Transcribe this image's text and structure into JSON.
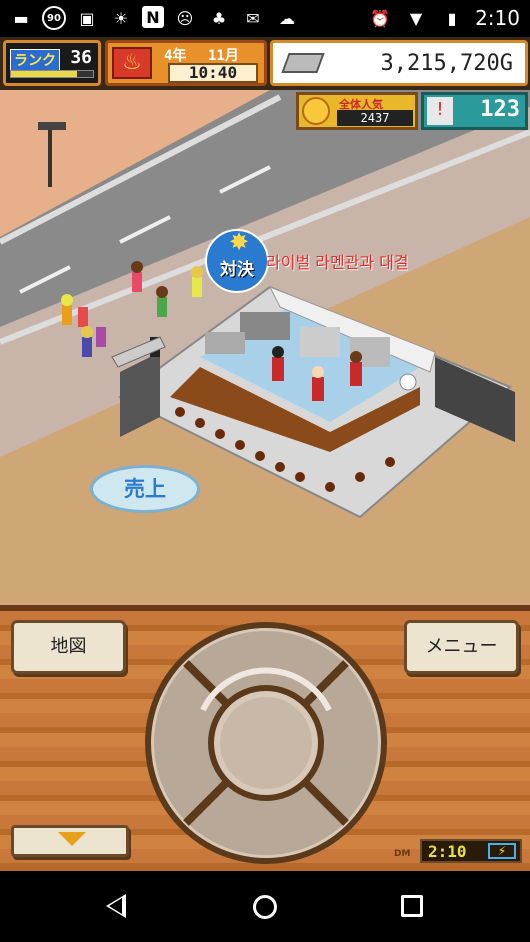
{
  "status_bar": {
    "time": "2:10",
    "notification_badge": "90",
    "icons": [
      "message-icon",
      "badge-90-icon",
      "image-icon",
      "weather-icon",
      "n-icon",
      "emoji-icon",
      "android-icon",
      "mail-icon",
      "cloud-icon"
    ],
    "right_icons": [
      "alarm-icon",
      "wifi-icon",
      "battery-icon"
    ]
  },
  "hud": {
    "rank_label": "ランク",
    "rank_value": "36",
    "rank_progress": 0.8,
    "year_label": "4年",
    "month_label": "11月",
    "time": "10:40",
    "money": "3,215,720G",
    "popularity_label": "全体人気",
    "popularity_value": "2437",
    "rival_value": "123"
  },
  "scene": {
    "vs_label": "対決",
    "vs_caption": "라이벌 라멘관과 대결",
    "sales_button": "売上"
  },
  "controller": {
    "map_button": "地図",
    "menu_button": "メニュー",
    "clock_time": "2:10",
    "clock_tag": "DM"
  },
  "colors": {
    "accent_orange": "#d88a2a",
    "wood": "#c8783a",
    "sales_blue": "#2a7ad0",
    "caption_red": "#e82a2a"
  }
}
